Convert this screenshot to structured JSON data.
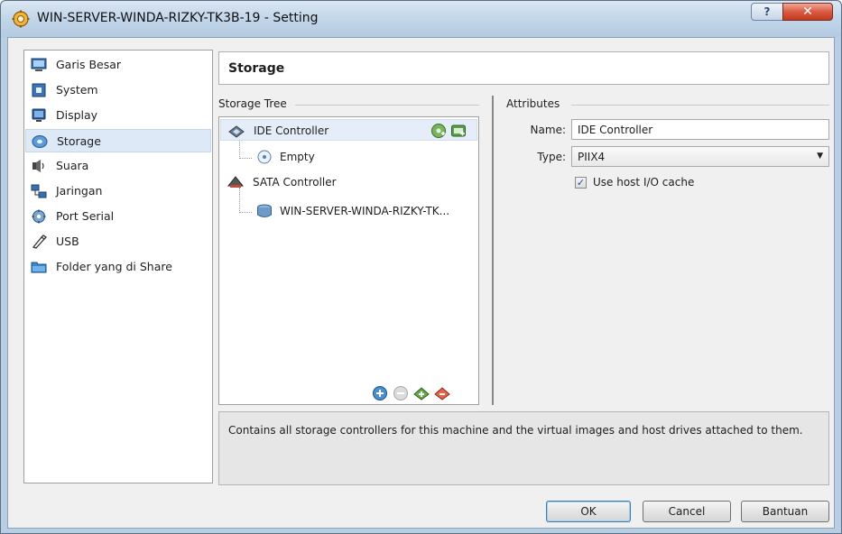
{
  "window": {
    "title": "WIN-SERVER-WINDA-RIZKY-TK3B-19 - Setting",
    "help_glyph": "?",
    "close_glyph": "✕"
  },
  "sidebar": {
    "items": [
      {
        "label": "Garis Besar",
        "icon": "general-icon"
      },
      {
        "label": "System",
        "icon": "system-chip-icon"
      },
      {
        "label": "Display",
        "icon": "display-monitor-icon"
      },
      {
        "label": "Storage",
        "icon": "storage-disk-icon",
        "selected": true
      },
      {
        "label": "Suara",
        "icon": "audio-icon"
      },
      {
        "label": "Jaringan",
        "icon": "network-icon"
      },
      {
        "label": "Port Serial",
        "icon": "serial-port-icon"
      },
      {
        "label": "USB",
        "icon": "usb-icon"
      },
      {
        "label": "Folder yang di Share",
        "icon": "shared-folder-icon"
      }
    ]
  },
  "page": {
    "title": "Storage"
  },
  "storage_tree": {
    "label": "Storage Tree",
    "nodes": [
      {
        "label": "IDE Controller",
        "type": "controller",
        "selected": true
      },
      {
        "label": "Empty",
        "type": "cd-drive",
        "parent": "IDE Controller"
      },
      {
        "label": "SATA Controller",
        "type": "controller"
      },
      {
        "label": "WIN-SERVER-WINDA-RIZKY-TK...",
        "type": "hard-disk",
        "parent": "SATA Controller"
      }
    ]
  },
  "attributes": {
    "label": "Attributes",
    "name_label": "Name:",
    "name_value": "IDE Controller",
    "type_label": "Type:",
    "type_value": "PIIX4",
    "host_io_cache_label": "Use host I/O cache",
    "host_io_cache_checked": true
  },
  "info": {
    "text": "Contains all storage controllers for this machine and the virtual images and host drives attached to them."
  },
  "buttons": {
    "ok": "OK",
    "cancel": "Cancel",
    "help": "Bantuan"
  },
  "colors": {
    "selection": "#dde9f6",
    "title_bar": "#c4d7ea",
    "close_button": "#d95b42"
  }
}
